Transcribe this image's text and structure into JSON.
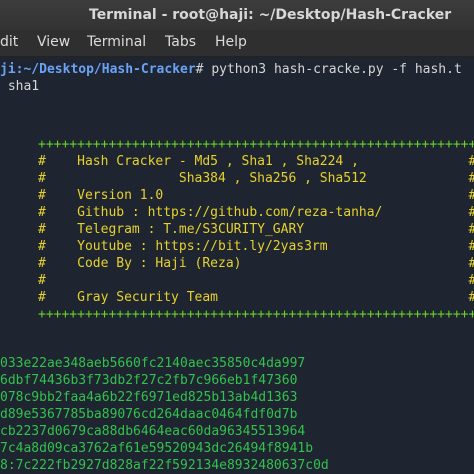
{
  "window": {
    "title": "Terminal - root@haji: ~/Desktop/Hash-Cracker"
  },
  "menu": [
    "dit",
    "View",
    "Terminal",
    "Tabs",
    "Help"
  ],
  "prompt": {
    "user_host": "ji",
    "path": ":~/Desktop/Hash-Cracker",
    "suffix": "# ",
    "command": "python3 hash-cracke.py -f hash.t"
  },
  "argline": " sha1",
  "banner": [
    "++++++++++++++++++++++++++++++++++++++++++++++++++++++++++",
    "#    Hash Cracker - Md5 , Sha1 , Sha224 ,              #",
    "#                 Sha384 , Sha256 , Sha512             #",
    "#    Version 1.0                                       #",
    "#    Github : https://github.com/reza-tanha/           #",
    "#    Telegram : T.me/S3CURITY_GARY                     #",
    "#    Youtube : https://bit.ly/2yas3rm                  #",
    "#    Code By : Haji (Reza)                             #",
    "#                                                      #",
    "#    Gray Security Team                                #",
    "++++++++++++++++++++++++++++++++++++++++++++++++++++++++++"
  ],
  "hashes": [
    "033e22ae348aeb5660fc2140aec35850c4da997",
    "6dbf74436b3f73db2f27c2fb7c966eb1f47360",
    "078c9bb2faa4a6b22f6971ed825b13ab4d1363",
    "d89e5367785ba89076cd264daac0464fdf0d7b",
    "cb2237d0679ca88db6464eac60da96345513964",
    "7c4a8d09ca3762af61e59520943dc26494f8941b",
    "8:7c222fb2927d828af22f592134e8932480637c0d"
  ]
}
